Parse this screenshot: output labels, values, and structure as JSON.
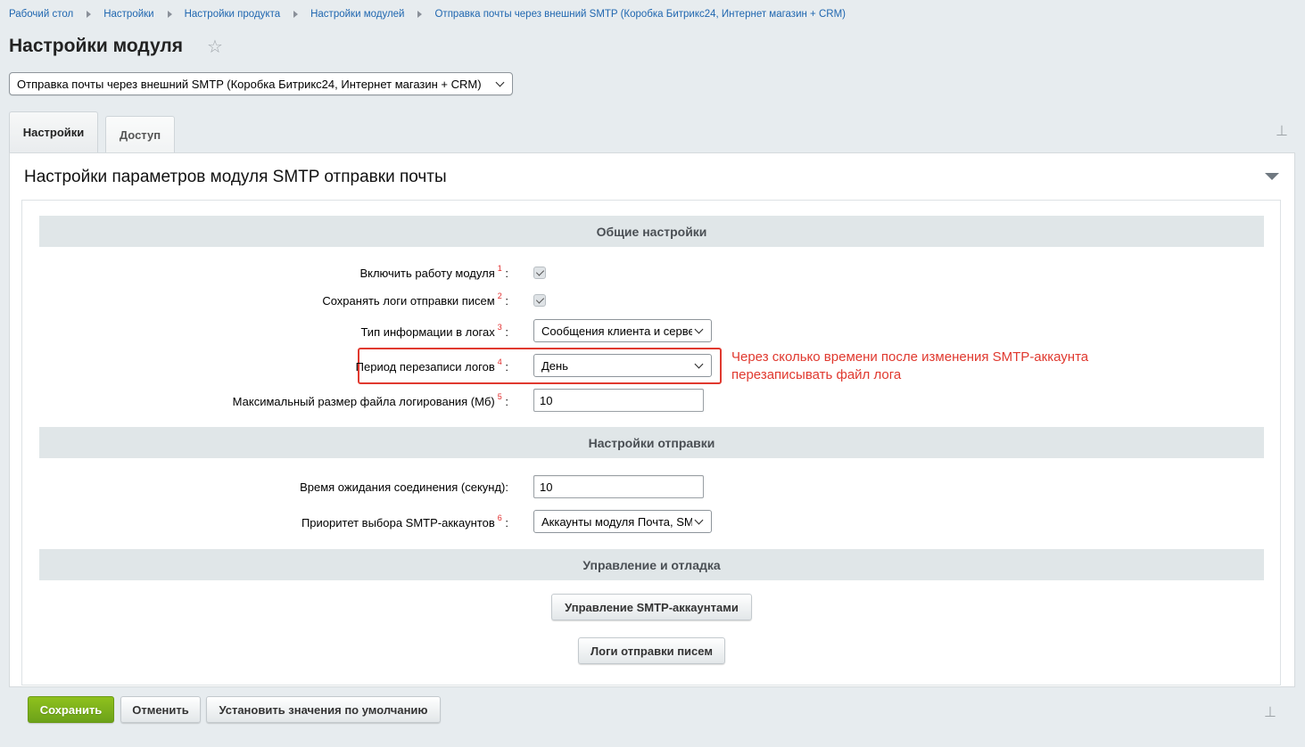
{
  "breadcrumb": [
    "Рабочий стол",
    "Настройки",
    "Настройки продукта",
    "Настройки модулей",
    "Отправка почты через внешний SMTP (Коробка Битрикс24, Интернет магазин + CRM)"
  ],
  "page_title": "Настройки модуля",
  "module_select": {
    "value": "Отправка почты через внешний SMTP (Коробка Битрикс24, Интернет магазин + CRM)"
  },
  "tabs": [
    {
      "label": "Настройки",
      "active": true
    },
    {
      "label": "Доступ",
      "active": false
    }
  ],
  "panel_title": "Настройки параметров модуля SMTP отправки почты",
  "sections": {
    "general": "Общие настройки",
    "sending": "Настройки отправки",
    "management": "Управление и отладка"
  },
  "fields": {
    "enable_module": {
      "label": "Включить работу модуля",
      "note": "1",
      "checked": true
    },
    "save_logs": {
      "label": "Сохранять логи отправки писем",
      "note": "2",
      "checked": true
    },
    "log_info_type": {
      "label": "Тип информации в логах",
      "note": "3",
      "value": "Сообщения клиента и сервера"
    },
    "log_period": {
      "label": "Период перезаписи логов",
      "note": "4",
      "value": "День"
    },
    "log_max_size": {
      "label": "Максимальный размер файла логирования (Мб)",
      "note": "5",
      "value": "10"
    },
    "connect_timeout": {
      "label": "Время ожидания соединения (секунд):",
      "value": "10"
    },
    "smtp_priority": {
      "label": "Приоритет выбора SMTP-аккаунтов",
      "note": "6",
      "value": "Аккаунты модуля Почта, SMTP"
    }
  },
  "colon": ":",
  "annotation": [
    "Через сколько времени после изменения SMTP-аккаунта",
    "перезаписывать файл лога"
  ],
  "buttons": {
    "manage_accounts": "Управление SMTP-аккаунтами",
    "send_logs": "Логи отправки писем",
    "save": "Сохранить",
    "cancel": "Отменить",
    "defaults": "Установить значения по умолчанию"
  },
  "colors": {
    "accent_link": "#2067b0",
    "primary_button": "#7cb11b",
    "annotation": "#e0392f"
  }
}
